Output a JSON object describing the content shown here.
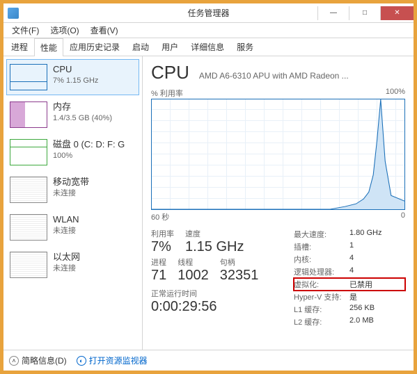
{
  "window": {
    "title": "任务管理器",
    "min": "—",
    "max": "□",
    "close": "✕"
  },
  "menu": {
    "file": "文件(F)",
    "options": "选项(O)",
    "view": "查看(V)"
  },
  "tabs": {
    "processes": "进程",
    "performance": "性能",
    "history": "应用历史记录",
    "startup": "启动",
    "users": "用户",
    "details": "详细信息",
    "services": "服务"
  },
  "sidebar": {
    "cpu": {
      "title": "CPU",
      "sub": "7% 1.15 GHz"
    },
    "mem": {
      "title": "内存",
      "sub": "1.4/3.5 GB (40%)"
    },
    "disk": {
      "title": "磁盘 0 (C: D: F: G",
      "sub": "100%"
    },
    "mobile": {
      "title": "移动宽带",
      "sub": "未连接"
    },
    "wlan": {
      "title": "WLAN",
      "sub": "未连接"
    },
    "eth": {
      "title": "以太网",
      "sub": "未连接"
    }
  },
  "main": {
    "title": "CPU",
    "subtitle": "AMD A6-6310 APU with AMD Radeon ...",
    "chart_top_left": "% 利用率",
    "chart_top_right": "100%",
    "chart_bot_left": "60 秒",
    "chart_bot_right": "0",
    "left_stats": {
      "util_lbl": "利用率",
      "util_val": "7%",
      "speed_lbl": "速度",
      "speed_val": "1.15 GHz",
      "proc_lbl": "进程",
      "proc_val": "71",
      "thr_lbl": "线程",
      "thr_val": "1002",
      "hnd_lbl": "句柄",
      "hnd_val": "32351",
      "uptime_lbl": "正常运行时间",
      "uptime_val": "0:00:29:56"
    },
    "right_stats": {
      "maxspeed_k": "最大速度:",
      "maxspeed_v": "1.80 GHz",
      "sockets_k": "插槽:",
      "sockets_v": "1",
      "cores_k": "内核:",
      "cores_v": "4",
      "logical_k": "逻辑处理器:",
      "logical_v": "4",
      "virt_k": "虚拟化:",
      "virt_v": "已禁用",
      "hyperv_k": "Hyper-V 支持:",
      "hyperv_v": "是",
      "l1_k": "L1 缓存:",
      "l1_v": "256 KB",
      "l2_k": "L2 缓存:",
      "l2_v": "2.0 MB"
    }
  },
  "footer": {
    "simple": "简略信息(D)",
    "monitor": "打开资源监视器"
  },
  "chart_data": {
    "type": "line",
    "title": "% 利用率",
    "xlabel": "60 秒",
    "ylabel": "",
    "ylim": [
      0,
      100
    ],
    "x_seconds_ago": [
      60,
      55,
      50,
      45,
      40,
      35,
      30,
      25,
      20,
      15,
      12,
      10,
      8,
      6,
      5,
      4,
      3,
      2,
      1,
      0
    ],
    "values": [
      0,
      0,
      0,
      0,
      0,
      0,
      0,
      0,
      0,
      0,
      3,
      5,
      8,
      15,
      30,
      60,
      100,
      40,
      12,
      7
    ]
  }
}
